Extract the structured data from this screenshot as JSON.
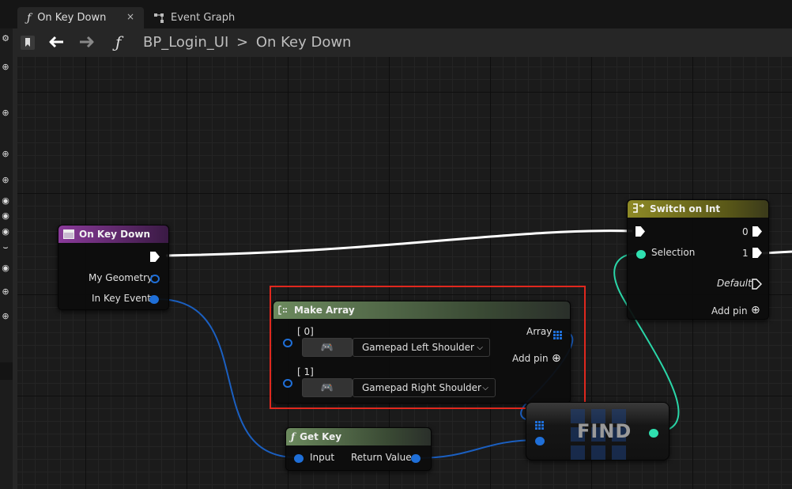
{
  "tabs": [
    {
      "icon": "function-icon",
      "label": "On Key Down",
      "active": true,
      "close": "×"
    },
    {
      "icon": "event-graph-icon",
      "label": "Event Graph",
      "active": false
    }
  ],
  "breadcrumb": {
    "blueprint": "BP_Login_UI",
    "separator": ">",
    "function": "On Key Down"
  },
  "nodes": {
    "on_key_down": {
      "title": "On Key Down",
      "pins": {
        "geometry": "My Geometry",
        "key_event": "In Key Event"
      }
    },
    "make_array": {
      "title": "Make Array",
      "index0": "[ 0]",
      "index1": "[ 1]",
      "value0": "Gamepad Left Shoulder",
      "value1": "Gamepad Right Shoulder",
      "output": "Array",
      "add_pin": "Add pin"
    },
    "get_key": {
      "title": "Get Key",
      "input": "Input",
      "output": "Return Value"
    },
    "find": {
      "title": "FIND"
    },
    "switch_on_int": {
      "title": "Switch on Int",
      "selection": "Selection",
      "out0": "0",
      "out1": "1",
      "default": "Default",
      "add_pin": "Add pin"
    }
  },
  "colors": {
    "event_header": "#7a2e8a",
    "pure_header": "#5a7a4c",
    "switch_header": "#7d7a22",
    "struct_pin": "#1f6fd8",
    "int_pin": "#2fe0b0",
    "highlight": "#e0281e"
  }
}
